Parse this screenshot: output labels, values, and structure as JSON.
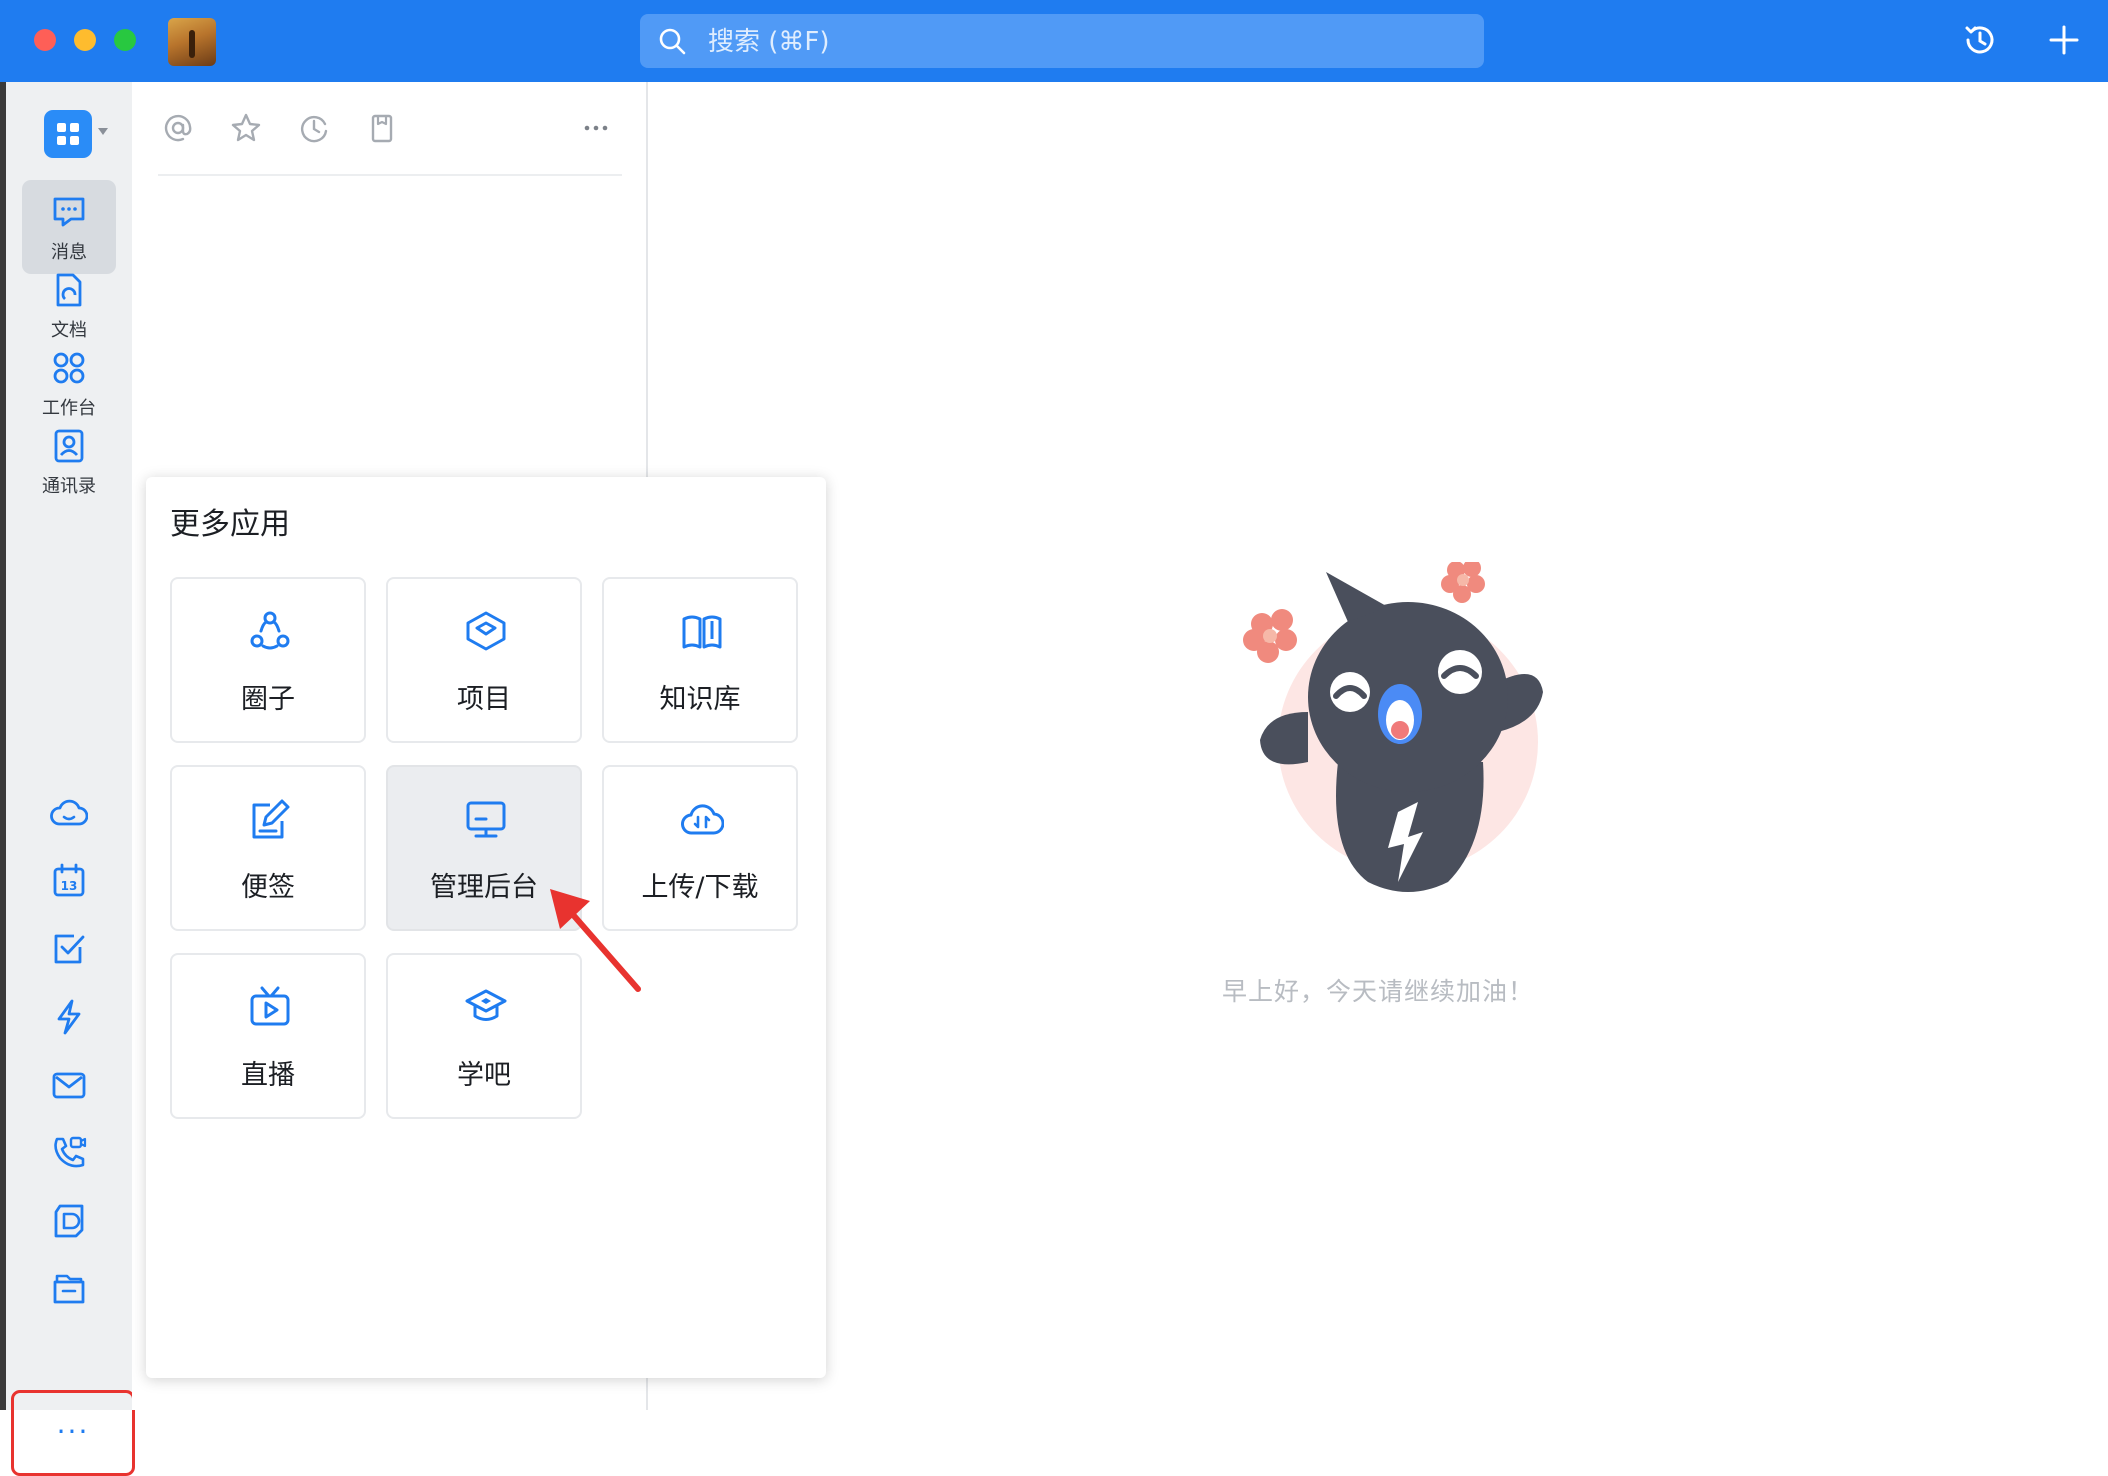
{
  "titlebar": {
    "search_placeholder": "搜索 (⌘F)",
    "accent_color": "#1f7cf0",
    "icons": [
      "history-icon",
      "plus-icon"
    ]
  },
  "sidebar": {
    "nav": [
      {
        "label": "消息",
        "icon": "message-icon",
        "active": true
      },
      {
        "label": "文档",
        "icon": "document-icon",
        "active": false
      },
      {
        "label": "工作台",
        "icon": "workbench-icon",
        "active": false
      },
      {
        "label": "通讯录",
        "icon": "contacts-icon",
        "active": false
      }
    ],
    "tools": [
      "cloud-icon",
      "calendar-icon",
      "todo-check-icon",
      "lightning-icon",
      "mail-icon",
      "video-call-icon",
      "note-icon",
      "folder-icon"
    ],
    "calendar_day": "13",
    "more_label": "···"
  },
  "listpanel": {
    "icons": [
      "mention-icon",
      "star-icon",
      "clock-icon",
      "bookmark-icon",
      "more-horizontal-icon"
    ]
  },
  "popup": {
    "title": "更多应用",
    "apps": [
      {
        "label": "圈子",
        "icon": "circle-group-icon"
      },
      {
        "label": "项目",
        "icon": "project-icon"
      },
      {
        "label": "知识库",
        "icon": "knowledge-base-icon"
      },
      {
        "label": "便签",
        "icon": "sticky-note-icon"
      },
      {
        "label": "管理后台",
        "icon": "admin-monitor-icon",
        "hovered": true
      },
      {
        "label": "上传/下载",
        "icon": "cloud-transfer-icon"
      },
      {
        "label": "直播",
        "icon": "live-tv-icon"
      },
      {
        "label": "学吧",
        "icon": "graduation-cap-icon"
      }
    ]
  },
  "main": {
    "greeting": "早上好，今天请继续加油！"
  },
  "annotations": {
    "highlight_color": "#e8332f"
  }
}
